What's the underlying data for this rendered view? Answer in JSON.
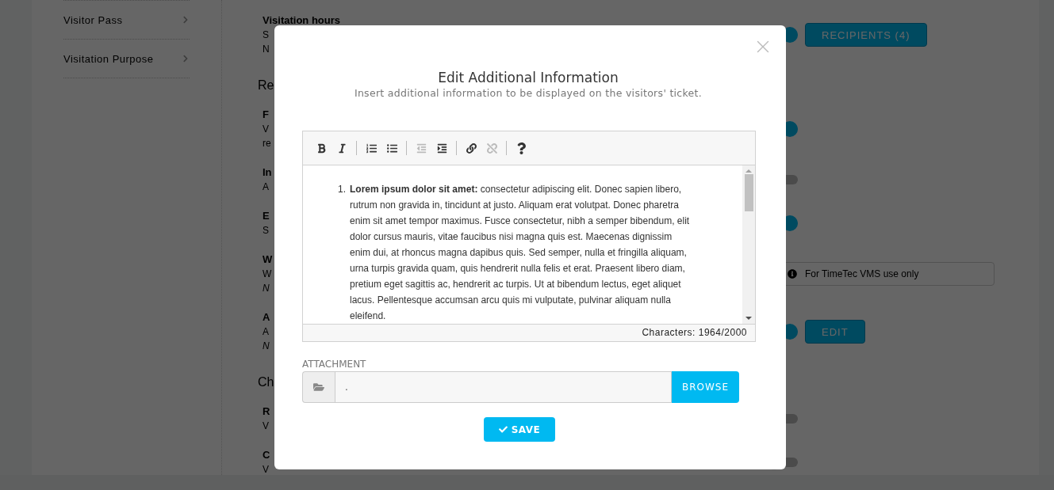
{
  "sidebar": {
    "items": [
      {
        "label": "Visitor Pass"
      },
      {
        "label": "Visitation Purpose"
      }
    ]
  },
  "sections": [
    {
      "items": [
        {
          "title": "Visitation hours",
          "lines": [
            "S",
            "N"
          ],
          "control": {
            "kind": "toggle",
            "on": true,
            "button": "RECIPIENTS (4)"
          }
        }
      ]
    },
    {
      "heading": "Re",
      "items": [
        {
          "title": "F",
          "lines": [
            "V",
            "re"
          ],
          "control": {
            "kind": "toggle",
            "on": true
          }
        },
        {
          "title": "In",
          "lines": [
            "A"
          ],
          "control": {
            "kind": "toggle",
            "on": false
          }
        },
        {
          "title": "E",
          "lines": [
            "S"
          ],
          "control": {
            "kind": "toggle",
            "on": true
          }
        },
        {
          "title": "W",
          "lines": [
            "W"
          ],
          "note": "N",
          "control": {
            "kind": "field",
            "value": "For TimeTec VMS use only"
          }
        },
        {
          "title": "A",
          "lines": [
            "A"
          ],
          "note": "N",
          "control": {
            "kind": "toggle",
            "on": true,
            "button": "EDIT"
          }
        }
      ]
    },
    {
      "heading": "Ch",
      "items": [
        {
          "title": "R",
          "lines": [
            "V"
          ],
          "control": {
            "kind": "toggle",
            "on": false
          }
        },
        {
          "title": "C",
          "lines": [
            "V"
          ],
          "control": {
            "kind": "toggle",
            "on": false
          }
        }
      ]
    }
  ],
  "dialog": {
    "title": "Edit Additional Information",
    "subtitle": "Insert additional information to be displayed on the visitors' ticket.",
    "toolbar": [
      {
        "kind": "bold",
        "disabled": false
      },
      {
        "kind": "italic",
        "disabled": false
      },
      {
        "kind": "sep"
      },
      {
        "kind": "ordered-list",
        "disabled": false
      },
      {
        "kind": "bullet-list",
        "disabled": false
      },
      {
        "kind": "sep"
      },
      {
        "kind": "outdent",
        "disabled": true
      },
      {
        "kind": "indent",
        "disabled": false
      },
      {
        "kind": "sep"
      },
      {
        "kind": "link",
        "disabled": false
      },
      {
        "kind": "unlink",
        "disabled": true
      },
      {
        "kind": "sep"
      },
      {
        "kind": "help",
        "disabled": false
      }
    ],
    "content": [
      {
        "marker": "1.",
        "text": "**Lorem ipsum dolor sit amet:** consectetur adipiscing elit. Donec sapien libero, rutrum non gravida in, tincidunt at justo. Aliquam erat volutpat. Donec pharetra enim sit amet tempor maximus. Fusce consectetur, nibh a semper bibendum, elit dolor cursus mauris, vitae faucibus nisi magna quis est. Maecenas dignissim enim dui, at rhoncus magna dapibus quis. Sed semper, nulla et fringilla aliquam, urna turpis gravida quam, quis hendrerit nulla felis et erat. Praesent libero diam, pretium eget sagittis ac, hendrerit ac turpis. Ut at bibendum lectus, eget aliquet lacus. Pellentesque accumsan arcu quis mi vulputate, pulvinar aliquam nulla eleifend."
      }
    ],
    "counter": "Characters: 1964/2000",
    "attachment": {
      "label": "ATTACHMENT",
      "value": ".",
      "button": "BROWSE"
    },
    "save": "SAVE"
  }
}
